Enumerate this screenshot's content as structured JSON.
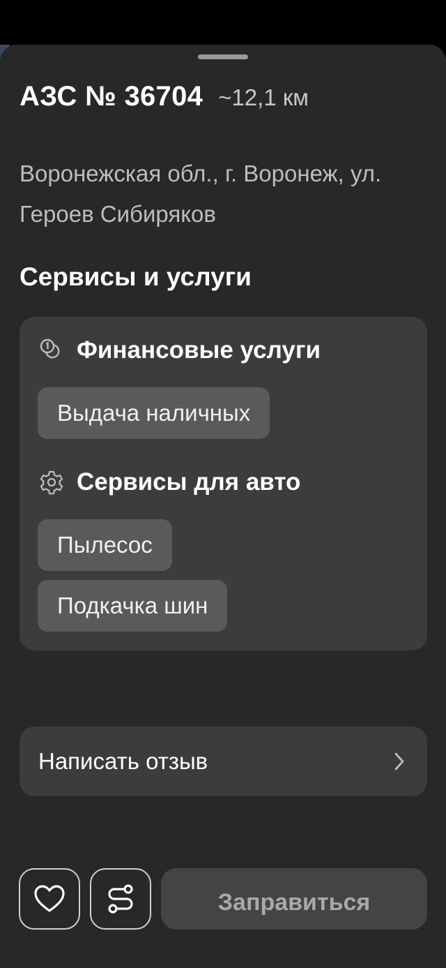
{
  "station": {
    "name": "АЗС № 36704",
    "distance": "~12,1 км",
    "address": "Воронежская обл., г. Воронеж, ул. Героев Сибиряков"
  },
  "services": {
    "title": "Сервисы и услуги",
    "categories": [
      {
        "icon": "coins-icon",
        "title": "Финансовые услуги",
        "items": [
          "Выдача наличных"
        ]
      },
      {
        "icon": "gear-icon",
        "title": "Сервисы для авто",
        "items": [
          "Пылесос",
          "Подкачка шин"
        ]
      }
    ]
  },
  "review": {
    "label": "Написать отзыв",
    "icon": "chevron-right-icon"
  },
  "actions": {
    "favorite_icon": "heart-icon",
    "route_icon": "route-icon",
    "refuel_label": "Заправиться"
  },
  "colors": {
    "sheet": "#282828",
    "card": "#3c3c3c",
    "chip": "#5a5a5a"
  }
}
